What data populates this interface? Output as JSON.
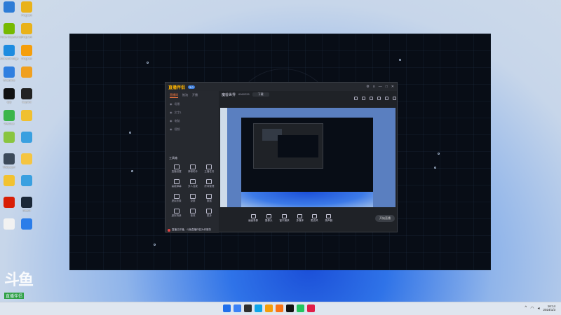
{
  "desktop": {
    "icons": [
      {
        "name": "windows-security-icon",
        "label": "",
        "color": "#2e7cd6"
      },
      {
        "name": "app-icon-1",
        "label": "Program",
        "color": "#e9b21a"
      },
      {
        "name": "nvidia-icon",
        "label": "GeForce Experience",
        "color": "#76b900"
      },
      {
        "name": "app-icon-2",
        "label": "Program",
        "color": "#e9b21a"
      },
      {
        "name": "edge-icon",
        "label": "Microsoft Edge",
        "color": "#1d8ce0"
      },
      {
        "name": "app-icon-3",
        "label": "Program",
        "color": "#f59e0b"
      },
      {
        "name": "onedrive-icon",
        "label": "OneDrive",
        "color": "#2f7fe0"
      },
      {
        "name": "help-icon",
        "label": "",
        "color": "#f0a020"
      },
      {
        "name": "qq-icon",
        "label": "QQ",
        "color": "#111111"
      },
      {
        "name": "capcut-icon",
        "label": "CapCut",
        "color": "#222222"
      },
      {
        "name": "wechat-icon",
        "label": "WeChat",
        "color": "#3bb54a"
      },
      {
        "name": "app-icon-4",
        "label": "",
        "color": "#f0c030"
      },
      {
        "name": "app-icon-5",
        "label": "",
        "color": "#89c540"
      },
      {
        "name": "app-icon-6",
        "label": "",
        "color": "#3aa0e0"
      },
      {
        "name": "wallpaper-icon",
        "label": "Wallpaper",
        "color": "#3c4a5a"
      },
      {
        "name": "folder-icon",
        "label": "",
        "color": "#f5c542"
      },
      {
        "name": "app-icon-7",
        "label": "",
        "color": "#f2c230"
      },
      {
        "name": "app-icon-8",
        "label": "",
        "color": "#3aa0e0"
      },
      {
        "name": "netease-music-icon",
        "label": "",
        "color": "#d81e06"
      },
      {
        "name": "steam-icon",
        "label": "Steam",
        "color": "#1b2838"
      },
      {
        "name": "file-icon",
        "label": "",
        "color": "#f2f2f2"
      },
      {
        "name": "media-icon",
        "label": "",
        "color": "#2b7de9"
      }
    ],
    "watermark": {
      "logo": "斗鱼",
      "sub": "直播伴侣"
    }
  },
  "app": {
    "logo": "直播伴侣",
    "version": "3.0",
    "title_controls": [
      "⚙",
      "≡",
      "—",
      "□",
      "✕"
    ],
    "tabs": [
      "直播间",
      "推流",
      "开播"
    ],
    "side_rows": [
      "场景",
      "文字1",
      "电脑",
      "视频"
    ],
    "tools_title": "工具箱",
    "tools": [
      "直播设置",
      "弹幕助手",
      "主播任务",
      "高能弹幕",
      "多人连麦",
      "房间管理",
      "虚拟形象",
      "录屏",
      "数据",
      "虚拟场景",
      "音效",
      "更多"
    ],
    "footer_notice": "直播已开播，斗鱼直播伴侣为你服务",
    "room": {
      "title": "魔兽世界",
      "id": "6960228",
      "pill": "下载"
    },
    "controls": [
      "画面录像",
      "摄像头",
      "窗口捕获",
      "多媒体",
      "麦克风",
      "扬声器"
    ],
    "start_label": "开始直播"
  },
  "taskbar": {
    "time": "16:14",
    "date": "2024/1/3",
    "colors": [
      "#1f6feb",
      "#3b82f6",
      "#2f2f2f",
      "#0ea5e9",
      "#f59e0b",
      "#f97316",
      "#111111",
      "#22c55e",
      "#e11d48"
    ]
  }
}
